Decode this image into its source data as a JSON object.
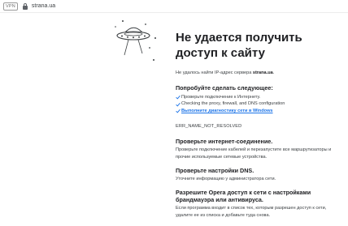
{
  "address_bar": {
    "vpn_label": "VPN",
    "url": "strana.ua"
  },
  "error": {
    "title": "Не удается получить доступ к сайту",
    "subtitle_prefix": "Не удалось найти IP-адрес сервера ",
    "subtitle_host": "strana.ua",
    "subtitle_suffix": ".",
    "try_heading": "Попробуйте сделать следующее:",
    "try_items": [
      {
        "text": "Проверьте подключение к Интернету.",
        "is_link": false
      },
      {
        "text": "Checking the proxy, firewall, and DNS configuration",
        "is_link": false
      },
      {
        "text": "Выполните диагностику сети в Windows",
        "is_link": true
      }
    ],
    "error_code": "ERR_NAME_NOT_RESOLVED",
    "sections": [
      {
        "heading": "Проверьте интернет-соединение.",
        "body": "Проверьте подключение кабелей и перезапустите все маршрутизаторы и прочие используемые сетевые устройства."
      },
      {
        "heading": "Проверьте настройки DNS.",
        "body": "Уточните информацию у администратора сети."
      },
      {
        "heading": "Разрешите Opera доступ к сети с настройками брандмауэра или антивируса.",
        "body": "Если программа входит в список тех, которым разрешен доступ к сети, удалите ее из списка и добавьте туда снова."
      }
    ]
  },
  "colors": {
    "link": "#1a73e8",
    "check": "#1a73e8",
    "text": "#202124"
  }
}
